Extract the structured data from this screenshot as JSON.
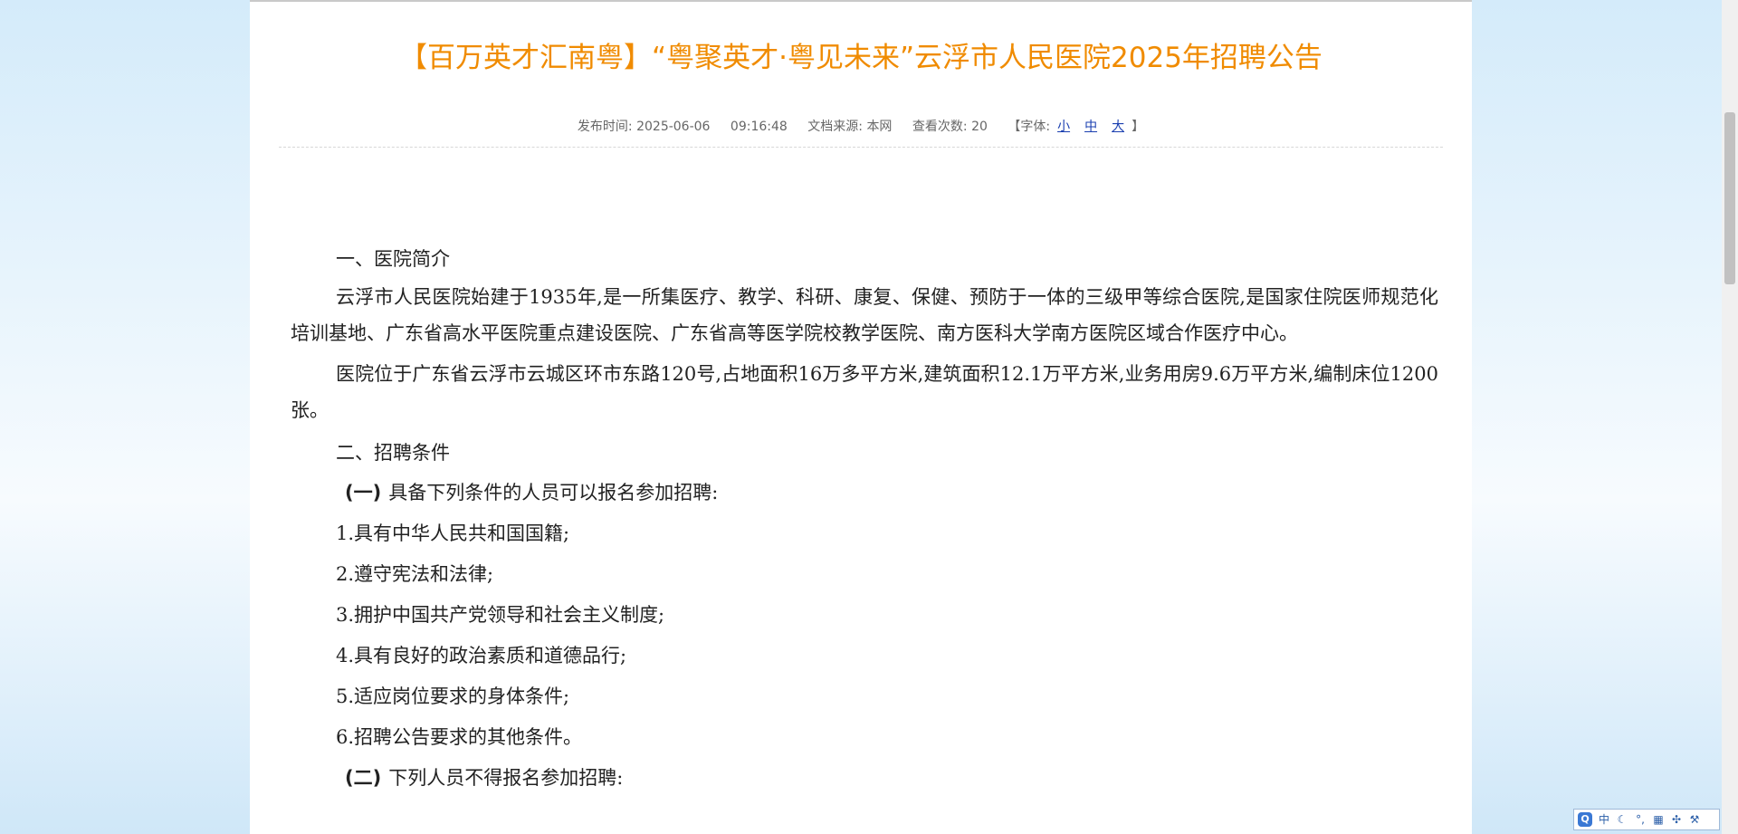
{
  "article": {
    "title": "【百万英才汇南粤】“粤聚英才·粤见未来”云浮市人民医院2025年招聘公告",
    "meta": {
      "publish_label": "发布时间:",
      "publish_date": "2025-06-06",
      "publish_time": "09:16:48",
      "source_label": "文档来源:",
      "source_value": "本网",
      "views_label": "查看次数:",
      "views_value": "20",
      "font_label": "【字体:",
      "font_small": "小",
      "font_medium": "中",
      "font_large": "大",
      "font_close": "】"
    },
    "sections": {
      "s1_heading": "一、医院简介",
      "s1_p1": "云浮市人民医院始建于1935年,是一所集医疗、教学、科研、康复、保健、预防于一体的三级甲等综合医院,是国家住院医师规范化培训基地、广东省高水平医院重点建设医院、广东省高等医学院校教学医院、南方医科大学南方医院区域合作医疗中心。",
      "s1_p2": "医院位于广东省云浮市云城区环市东路120号,占地面积16万多平方米,建筑面积12.1万平方米,业务用房9.6万平方米,编制床位1200张。",
      "s2_heading": "二、招聘条件",
      "s2_sub1_marker": "(一)",
      "s2_sub1_text": "具备下列条件的人员可以报名参加招聘:",
      "items": [
        "1.具有中华人民共和国国籍;",
        "2.遵守宪法和法律;",
        "3.拥护中国共产党领导和社会主义制度;",
        "4.具有良好的政治素质和道德品行;",
        "5.适应岗位要求的身体条件;",
        "6.招聘公告要求的其他条件。"
      ],
      "s2_sub2_marker": "(二)",
      "s2_sub2_text": "下列人员不得报名参加招聘:"
    }
  },
  "ime": {
    "logo": "Q",
    "lang": "中"
  },
  "colors": {
    "title": "#f08b00",
    "link": "#1a3fb0",
    "meta_text": "#666666"
  }
}
